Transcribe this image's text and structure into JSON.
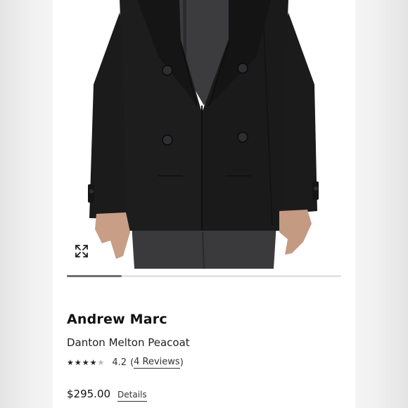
{
  "product": {
    "brand": "Andrew Marc",
    "name": "Danton Melton Peacoat",
    "rating": {
      "value": "4.2",
      "stars_out_of_5": 4.2,
      "reviews_open": "(",
      "reviews_link": "4 Reviews",
      "reviews_close": ")"
    },
    "price": "$295.00",
    "details_label": "Details"
  },
  "gallery": {
    "progress_fraction": 0.2,
    "expand_icon": "expand-arrows-icon",
    "image_subject": "black double-breasted wool peacoat worn over grey knit sweater"
  },
  "colors": {
    "coat": "#1b1b1c",
    "sweater": "#3c3c3e",
    "pants": "#3a3a3d",
    "progress_fill": "#6f6f6f",
    "progress_track": "#e3e3e3"
  }
}
